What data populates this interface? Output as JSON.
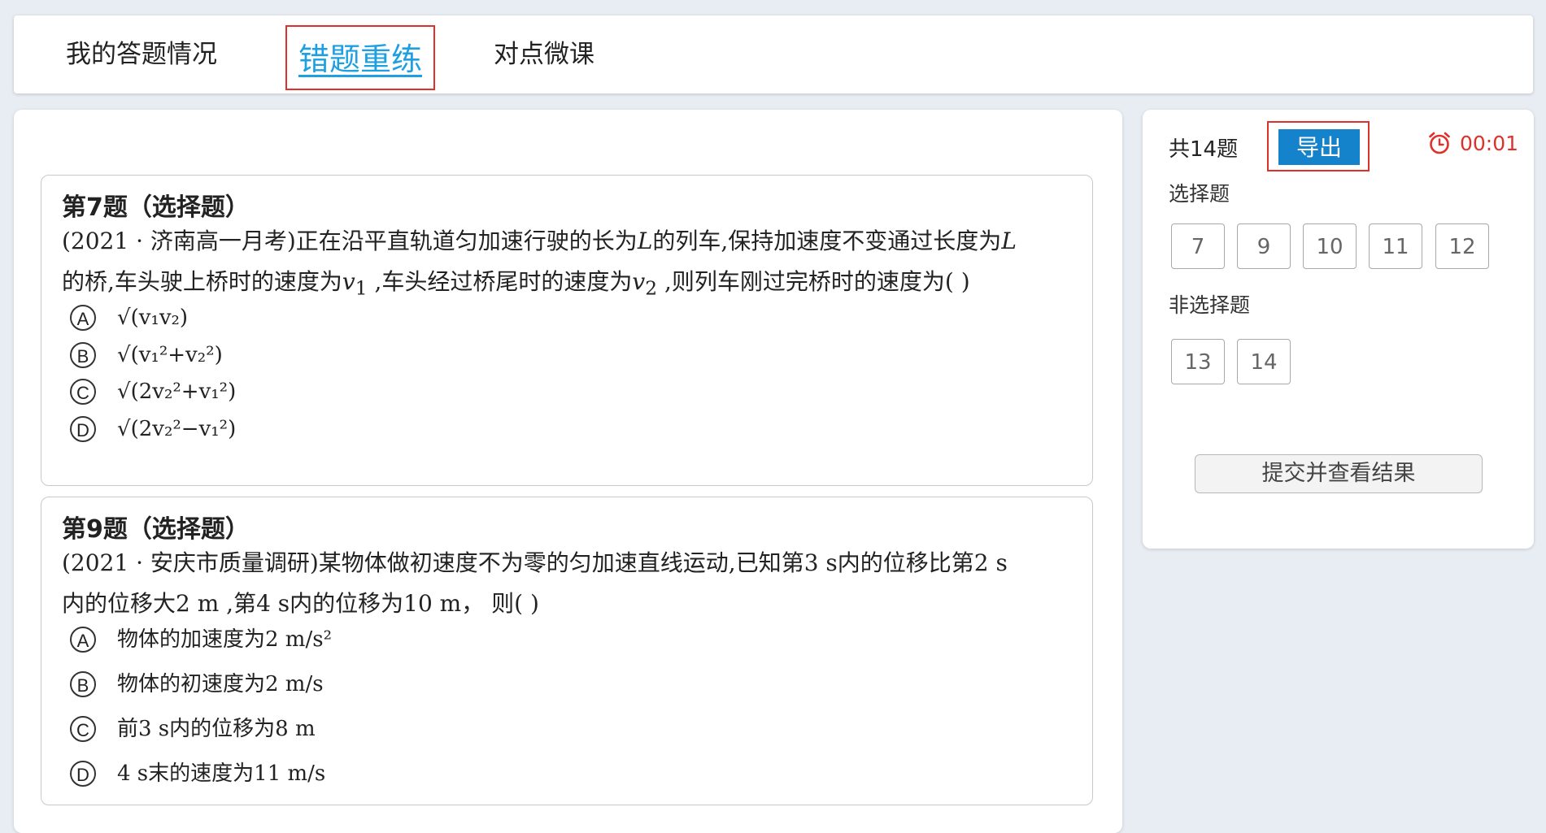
{
  "tabs": [
    {
      "label": "我的答题情况"
    },
    {
      "label": "错题重练"
    },
    {
      "label": "对点微课"
    }
  ],
  "questions": [
    {
      "title": "第7题（选择题）",
      "body": [
        "(2021 · 济南高一月考)正在沿平直轨道匀加速行驶的长为",
        "L",
        "的列车,保持加速度不变通过长度为",
        "L",
        "的桥,车头驶上桥时的速度为",
        "v",
        "1",
        " ,车头经过桥尾时的速度为",
        "v",
        "2",
        " ,则列车刚过完桥时的速度为(      )"
      ],
      "options": [
        {
          "letter": "A",
          "text": "√(v₁v₂)"
        },
        {
          "letter": "B",
          "text": "√(v₁²+v₂²)"
        },
        {
          "letter": "C",
          "text": "√(2v₂²+v₁²)"
        },
        {
          "letter": "D",
          "text": "√(2v₂²−v₁²)"
        }
      ]
    },
    {
      "title": "第9题（选择题）",
      "body": [
        "(2021 · 安庆市质量调研)某物体做初速度不为零的匀加速直线运动,已知第3 s内的位移比第2 s",
        "内的位移大2 m ,第4 s内的位移为10 m， 则(      )"
      ],
      "options": [
        {
          "letter": "A",
          "text": "物体的加速度为2 m/s²"
        },
        {
          "letter": "B",
          "text": "物体的初速度为2 m/s"
        },
        {
          "letter": "C",
          "text": "前3 s内的位移为8 m"
        },
        {
          "letter": "D",
          "text": "4 s末的速度为11 m/s"
        }
      ]
    }
  ],
  "sidebar": {
    "total": "共14题",
    "export_label": "导出",
    "timer": "00:01",
    "choice_label": "选择题",
    "choice_numbers": [
      "7",
      "9",
      "10",
      "11",
      "12"
    ],
    "nonchoice_label": "非选择题",
    "nonchoice_numbers": [
      "13",
      "14"
    ],
    "submit_label": "提交并查看结果"
  },
  "colors": {
    "accent": "#1ea0e0",
    "export": "#1583cc",
    "highlight_border": "#e0302a",
    "timer": "#e0302a"
  }
}
